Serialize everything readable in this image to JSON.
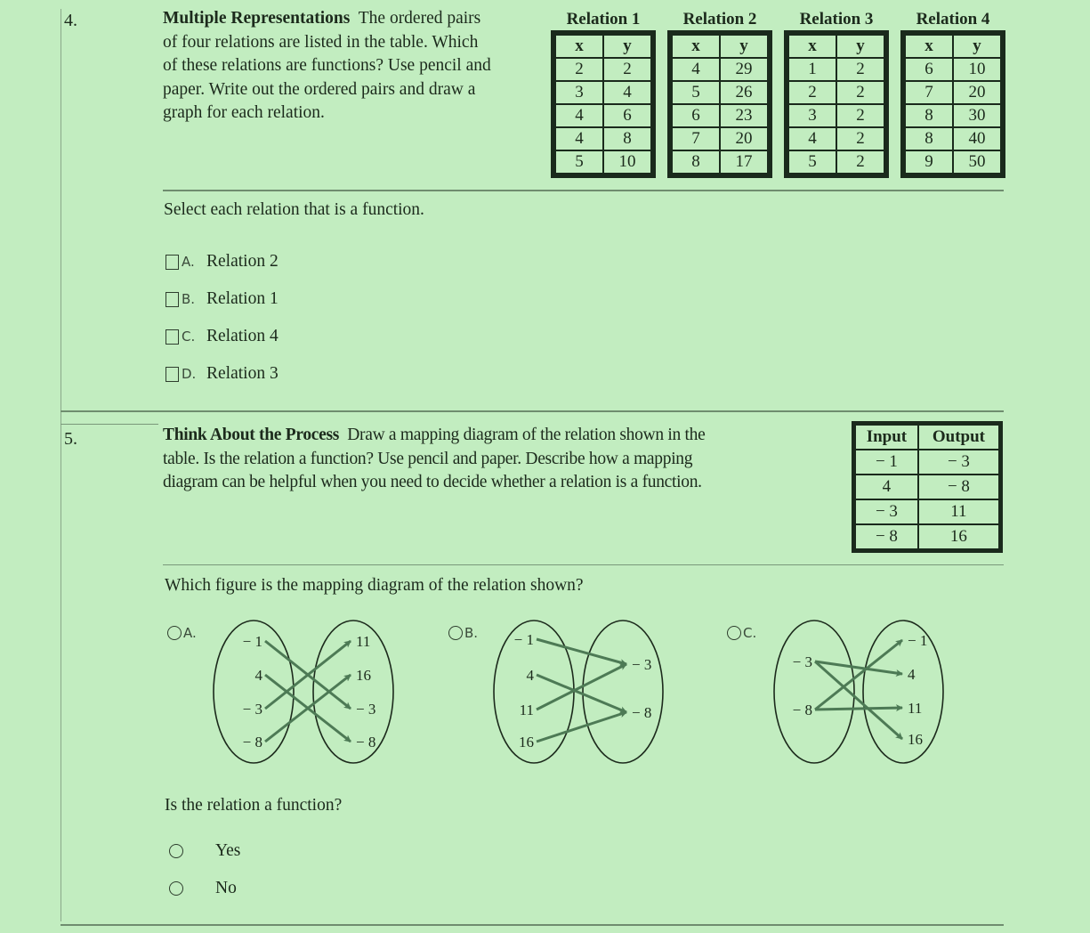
{
  "q4": {
    "number": "4.",
    "title": "Multiple Representations",
    "prompt_lines": [
      "The ordered pairs",
      "of four relations are listed in the table. Which",
      "of these relations are functions? Use pencil and",
      "paper. Write out the ordered pairs and draw a",
      "graph for each relation."
    ],
    "relations": [
      {
        "title": "Relation 1",
        "headers": [
          "x",
          "y"
        ],
        "rows": [
          [
            "2",
            "2"
          ],
          [
            "3",
            "4"
          ],
          [
            "4",
            "6"
          ],
          [
            "4",
            "8"
          ],
          [
            "5",
            "10"
          ]
        ]
      },
      {
        "title": "Relation 2",
        "headers": [
          "x",
          "y"
        ],
        "rows": [
          [
            "4",
            "29"
          ],
          [
            "5",
            "26"
          ],
          [
            "6",
            "23"
          ],
          [
            "7",
            "20"
          ],
          [
            "8",
            "17"
          ]
        ]
      },
      {
        "title": "Relation 3",
        "headers": [
          "x",
          "y"
        ],
        "rows": [
          [
            "1",
            "2"
          ],
          [
            "2",
            "2"
          ],
          [
            "3",
            "2"
          ],
          [
            "4",
            "2"
          ],
          [
            "5",
            "2"
          ]
        ]
      },
      {
        "title": "Relation 4",
        "headers": [
          "x",
          "y"
        ],
        "rows": [
          [
            "6",
            "10"
          ],
          [
            "7",
            "20"
          ],
          [
            "8",
            "30"
          ],
          [
            "8",
            "40"
          ],
          [
            "9",
            "50"
          ]
        ]
      }
    ],
    "instruction": "Select each relation that is a function.",
    "options": [
      {
        "letter": "A.",
        "label": "Relation 2",
        "checked": false
      },
      {
        "letter": "B.",
        "label": "Relation 1",
        "checked": false
      },
      {
        "letter": "C.",
        "label": "Relation 4",
        "checked": false
      },
      {
        "letter": "D.",
        "label": "Relation 3",
        "checked": false
      }
    ]
  },
  "q5": {
    "number": "5.",
    "title": "Think About the Process",
    "prompt_lines": [
      "Draw a mapping diagram of the relation shown in the",
      "table. Is the relation a function? Use pencil and paper. Describe how a mapping",
      "diagram can be helpful when you need to decide whether a relation is a function."
    ],
    "table": {
      "headers": [
        "Input",
        "Output"
      ],
      "rows": [
        [
          "− 1",
          "− 3"
        ],
        [
          "4",
          "− 8"
        ],
        [
          "− 3",
          "11"
        ],
        [
          "− 8",
          "16"
        ]
      ]
    },
    "mapping_question": "Which figure is the mapping diagram of the relation shown?",
    "diagrams": [
      {
        "letter": "A.",
        "inputs": [
          "− 1",
          "4",
          "− 3",
          "− 8"
        ],
        "outputs": [
          "11",
          "16",
          "− 3",
          "− 8"
        ],
        "arrows": [
          [
            0,
            2
          ],
          [
            1,
            3
          ],
          [
            2,
            0
          ],
          [
            3,
            1
          ]
        ]
      },
      {
        "letter": "B.",
        "inputs": [
          "− 1",
          "4",
          "11",
          "16"
        ],
        "outputs": [
          "− 3",
          "− 8"
        ],
        "arrows": [
          [
            0,
            0
          ],
          [
            1,
            1
          ],
          [
            2,
            0
          ],
          [
            3,
            1
          ]
        ]
      },
      {
        "letter": "C.",
        "inputs": [
          "− 3",
          "− 8"
        ],
        "outputs": [
          "− 1",
          "4",
          "11",
          "16"
        ],
        "arrows": [
          [
            0,
            1
          ],
          [
            0,
            3
          ],
          [
            1,
            0
          ],
          [
            1,
            2
          ]
        ]
      }
    ],
    "function_question": "Is the relation a function?",
    "function_options": [
      {
        "label": "Yes",
        "selected": false
      },
      {
        "label": "No",
        "selected": false
      }
    ]
  },
  "colors": {
    "background": "#c2edc0",
    "arrow": "#4d7a55",
    "ink": "#1c2a1c"
  }
}
